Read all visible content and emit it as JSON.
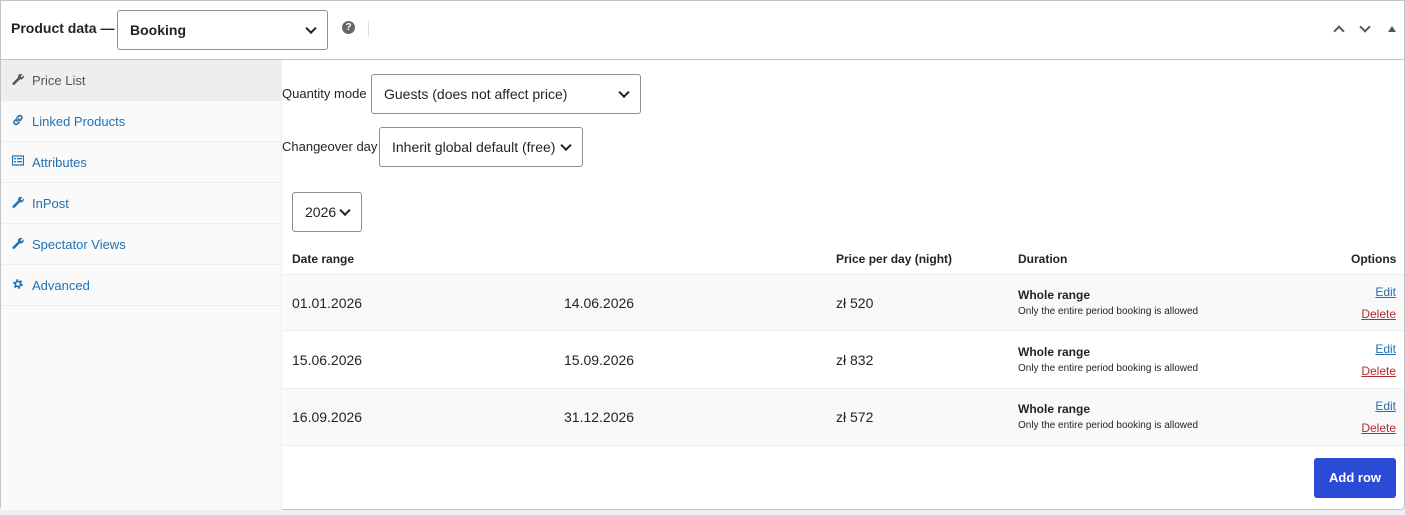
{
  "header": {
    "title": "Product data —",
    "product_type": "Booking"
  },
  "sidebar": {
    "items": [
      {
        "label": "Price List",
        "icon": "wrench-icon"
      },
      {
        "label": "Linked Products",
        "icon": "link-icon"
      },
      {
        "label": "Attributes",
        "icon": "list-icon"
      },
      {
        "label": "InPost",
        "icon": "wrench-icon"
      },
      {
        "label": "Spectator Views",
        "icon": "wrench-icon"
      },
      {
        "label": "Advanced",
        "icon": "gear-icon"
      }
    ]
  },
  "fields": {
    "quantity_mode_label": "Quantity mode",
    "quantity_mode_value": "Guests (does not affect price)",
    "changeover_label": "Changeover day",
    "changeover_value": "Inherit global default (free)",
    "year_value": "2026"
  },
  "table": {
    "headers": {
      "date_range": "Date range",
      "price": "Price per day (night)",
      "duration": "Duration",
      "options": "Options"
    },
    "rows": [
      {
        "from": "01.01.2026",
        "to": "14.06.2026",
        "price": "zł 520",
        "duration_title": "Whole range",
        "duration_sub": "Only the entire period booking is allowed",
        "edit": "Edit",
        "delete": "Delete"
      },
      {
        "from": "15.06.2026",
        "to": "15.09.2026",
        "price": "zł 832",
        "duration_title": "Whole range",
        "duration_sub": "Only the entire period booking is allowed",
        "edit": "Edit",
        "delete": "Delete"
      },
      {
        "from": "16.09.2026",
        "to": "31.12.2026",
        "price": "zł 572",
        "duration_title": "Whole range",
        "duration_sub": "Only the entire period booking is allowed",
        "edit": "Edit",
        "delete": "Delete"
      }
    ],
    "add_row": "Add row"
  },
  "colors": {
    "link": "#2271b1",
    "delete": "#b32d2e",
    "primary_button": "#2a4bd6"
  }
}
